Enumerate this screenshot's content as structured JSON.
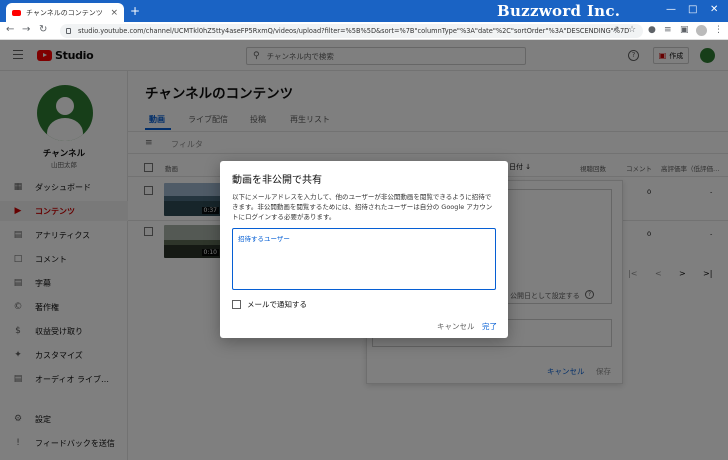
{
  "browser": {
    "tab_title": "チャンネルのコンテンツ - YouTube Studio",
    "tab_close": "×",
    "new_tab": "+",
    "brand": "Buzzword Inc.",
    "url": "studio.youtube.com/channel/UCMTkl0hZ5tty4aseFP5RxmQ/videos/upload?filter=%5B%5D&sort=%7B\"columnType\"%3A\"date\"%2C\"sortOrder\"%3A\"DESCENDING\"%7D"
  },
  "header": {
    "logo_text": "Studio",
    "search_placeholder": "チャンネル内で検索",
    "create_label": "作成"
  },
  "channel": {
    "name": "チャンネル",
    "owner": "山田太郎"
  },
  "sidebar": {
    "items": [
      {
        "label": "ダッシュボード",
        "icon": "dashboard-icon"
      },
      {
        "label": "コンテンツ",
        "icon": "content-icon",
        "active": true
      },
      {
        "label": "アナリティクス",
        "icon": "analytics-icon"
      },
      {
        "label": "コメント",
        "icon": "comments-icon"
      },
      {
        "label": "字幕",
        "icon": "subtitles-icon"
      },
      {
        "label": "著作権",
        "icon": "copyright-icon"
      },
      {
        "label": "収益受け取り",
        "icon": "monetization-icon"
      },
      {
        "label": "カスタマイズ",
        "icon": "customization-icon"
      },
      {
        "label": "オーディオ ライブ…",
        "icon": "audio-library-icon"
      }
    ],
    "bottom": [
      {
        "label": "設定",
        "icon": "settings-icon"
      },
      {
        "label": "フィードバックを送信",
        "icon": "feedback-icon"
      }
    ]
  },
  "main": {
    "title": "チャンネルのコンテンツ",
    "tabs": [
      "動画",
      "ライブ配信",
      "投稿",
      "再生リスト"
    ],
    "filter_label": "フィルタ",
    "columns": [
      "動画",
      "日付 ↓",
      "視聴回数",
      "コメント",
      "高評価率（低評価…"
    ],
    "rows": [
      {
        "duration": "0:37",
        "comments": "0",
        "likes": "-"
      },
      {
        "duration": "0:10",
        "comments": "0",
        "likes": "-"
      }
    ],
    "bg_set_label": "公開日として設定する",
    "bg_cancel": "キャンセル",
    "bg_save": "保存",
    "pager": [
      "|<",
      "<",
      ">",
      ">|"
    ]
  },
  "dialog": {
    "title": "動画を非公開で共有",
    "description": "以下にメールアドレスを入力して、他のユーザーが非公開動画を閲覧できるように招待できます。非公開動画を閲覧するためには、招待されたユーザーは自分の Google アカウントにログインする必要があります。",
    "input_label": "招待するユーザー",
    "notify_label": "メールで通知する",
    "notify_checked": false,
    "cancel_label": "キャンセル",
    "done_label": "完了"
  },
  "colors": {
    "accent": "#065fd4",
    "brand_red": "#ff0000",
    "active_red": "#cc0000",
    "tabstrip": "#1a63c4"
  }
}
